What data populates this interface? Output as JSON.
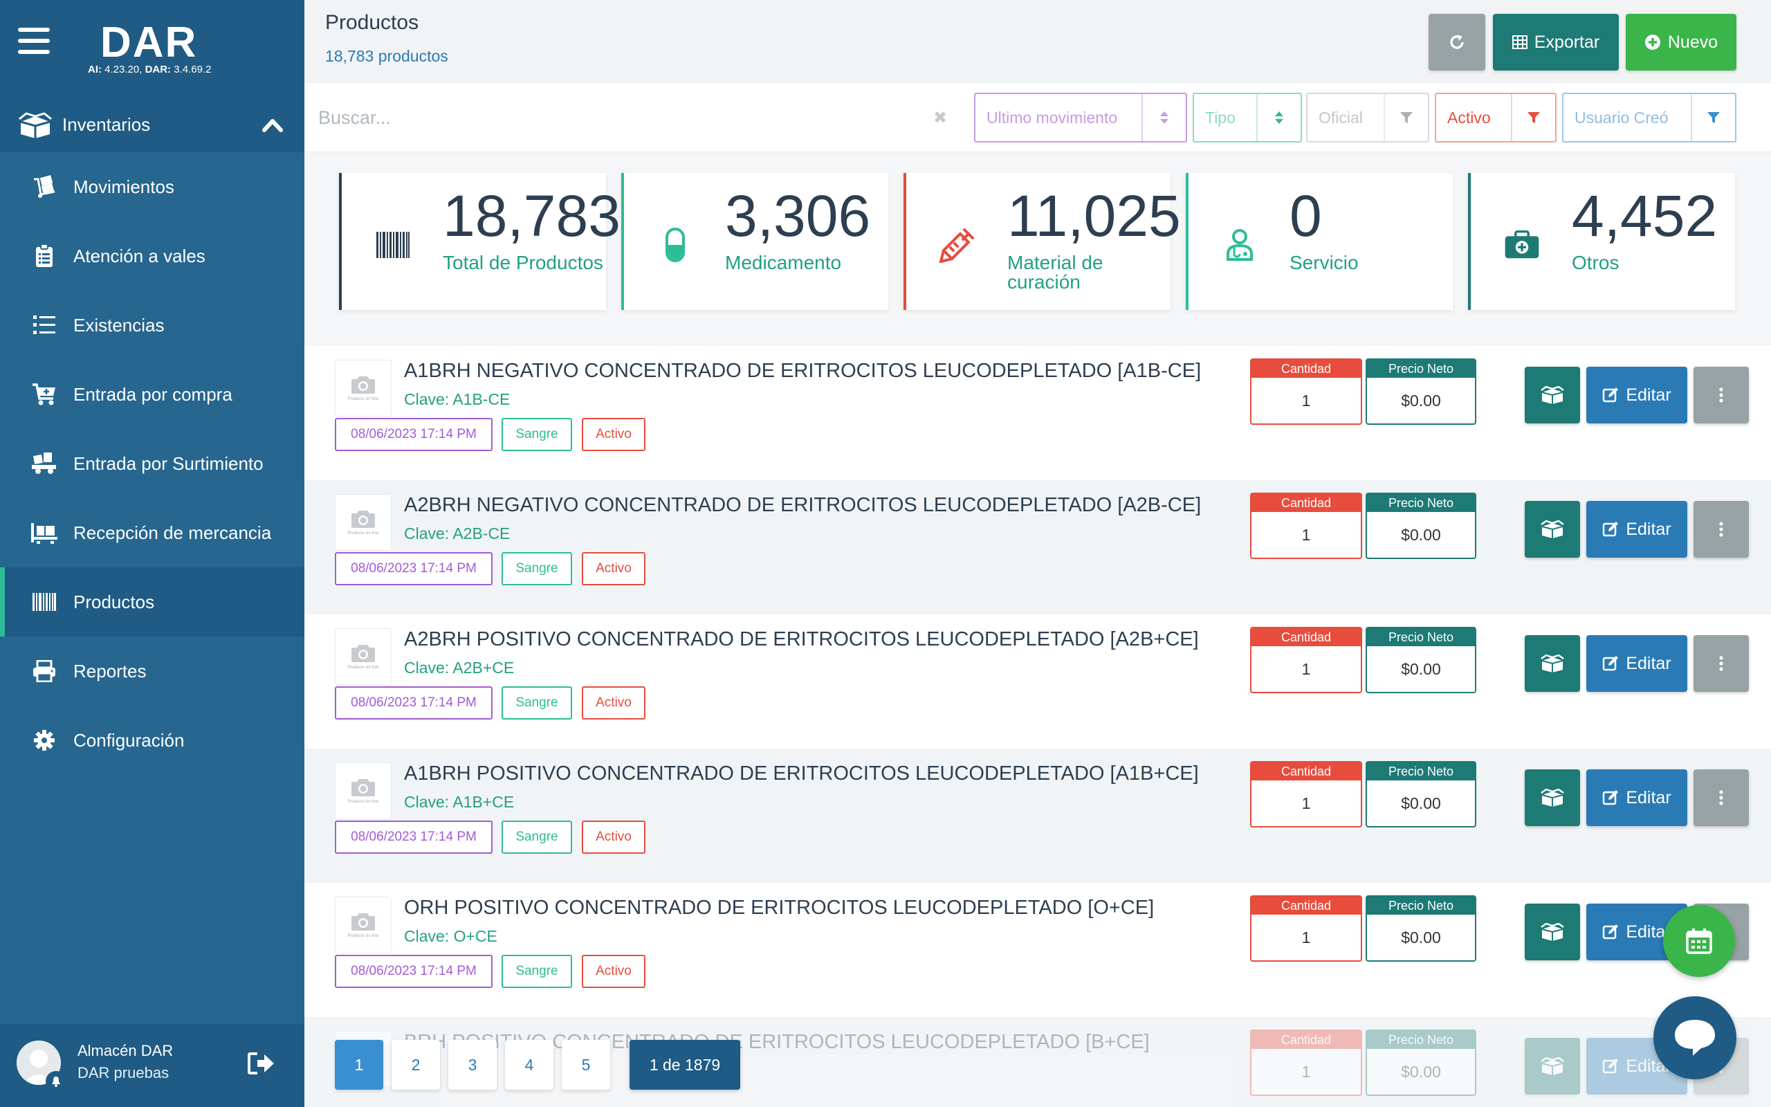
{
  "app": {
    "logo": "DAR",
    "ai_label": "AI:",
    "ai_version": "4.23.20,",
    "dar_label": "DAR:",
    "dar_version": "3.4.69.2"
  },
  "sidebar": {
    "section": "Inventarios",
    "items": [
      {
        "label": "Movimientos",
        "icon": "dolly-icon"
      },
      {
        "label": "Atención a vales",
        "icon": "clipboard-icon"
      },
      {
        "label": "Existencias",
        "icon": "list-ol-icon"
      },
      {
        "label": "Entrada por compra",
        "icon": "cart-plus-icon"
      },
      {
        "label": "Entrada por Surtimiento",
        "icon": "truck-loading-icon"
      },
      {
        "label": "Recepción de mercancia",
        "icon": "pallet-icon"
      },
      {
        "label": "Productos",
        "icon": "barcode-icon"
      },
      {
        "label": "Reportes",
        "icon": "print-icon"
      },
      {
        "label": "Configuración",
        "icon": "gear-icon"
      }
    ],
    "active_index": 6,
    "user": {
      "name": "Almacén DAR",
      "subtitle": "DAR pruebas"
    }
  },
  "header": {
    "title": "Productos",
    "count": "18,783 productos",
    "export_label": "Exportar",
    "new_label": "Nuevo"
  },
  "filters": {
    "search_placeholder": "Buscar...",
    "clear_symbol": "✖",
    "ultimo_movimiento": "Ultimo movimiento",
    "tipo": "Tipo",
    "oficial": "Oficial",
    "activo": "Activo",
    "usuario": "Usuario Creó"
  },
  "stats": [
    {
      "value": "18,783",
      "label": "Total de Productos",
      "label2": "",
      "color": "#2d3e50",
      "icon": "barcode-icon"
    },
    {
      "value": "3,306",
      "label": "Medicamento",
      "label2": "",
      "color": "#2dbd96",
      "icon": "capsule-icon"
    },
    {
      "value": "11,025",
      "label": "Material de",
      "label2": "curación",
      "color": "#e74c3c",
      "icon": "syringe-icon"
    },
    {
      "value": "0",
      "label": "Servicio",
      "label2": "",
      "color": "#2dbd96",
      "icon": "doctor-icon"
    },
    {
      "value": "4,452",
      "label": "Otros",
      "label2": "",
      "color": "#1d7a75",
      "icon": "medkit-icon"
    }
  ],
  "products": [
    {
      "name": "A1BRH NEGATIVO CONCENTRADO DE ERITROCITOS LEUCODEPLETADO [A1B-CE]",
      "clave": "Clave: A1B-CE",
      "date": "08/06/2023 17:14 PM",
      "category": "Sangre",
      "status": "Activo",
      "cantidad": "1",
      "precio": "$0.00"
    },
    {
      "name": "A2BRH NEGATIVO CONCENTRADO DE ERITROCITOS LEUCODEPLETADO [A2B-CE]",
      "clave": "Clave: A2B-CE",
      "date": "08/06/2023 17:14 PM",
      "category": "Sangre",
      "status": "Activo",
      "cantidad": "1",
      "precio": "$0.00"
    },
    {
      "name": "A2BRH POSITIVO CONCENTRADO DE ERITROCITOS LEUCODEPLETADO [A2B+CE]",
      "clave": "Clave: A2B+CE",
      "date": "08/06/2023 17:14 PM",
      "category": "Sangre",
      "status": "Activo",
      "cantidad": "1",
      "precio": "$0.00"
    },
    {
      "name": "A1BRH POSITIVO CONCENTRADO DE ERITROCITOS LEUCODEPLETADO [A1B+CE]",
      "clave": "Clave: A1B+CE",
      "date": "08/06/2023 17:14 PM",
      "category": "Sangre",
      "status": "Activo",
      "cantidad": "1",
      "precio": "$0.00"
    },
    {
      "name": "ORH POSITIVO CONCENTRADO DE ERITROCITOS LEUCODEPLETADO [O+CE]",
      "clave": "Clave: O+CE",
      "date": "08/06/2023 17:14 PM",
      "category": "Sangre",
      "status": "Activo",
      "cantidad": "1",
      "precio": "$0.00"
    },
    {
      "name": "BRH POSITIVO CONCENTRADO DE ERITROCITOS LEUCODEPLETADO [B+CE]",
      "clave": "",
      "date": "",
      "category": "",
      "status": "",
      "cantidad": "1",
      "precio": "$0.00"
    }
  ],
  "row_labels": {
    "cantidad": "Cantidad",
    "precio": "Precio Neto",
    "edit": "Editar",
    "thumb_text": "Producto sin foto"
  },
  "pagination": {
    "pages": [
      "1",
      "2",
      "3",
      "4",
      "5"
    ],
    "active": "1",
    "info": "1 de 1879"
  }
}
